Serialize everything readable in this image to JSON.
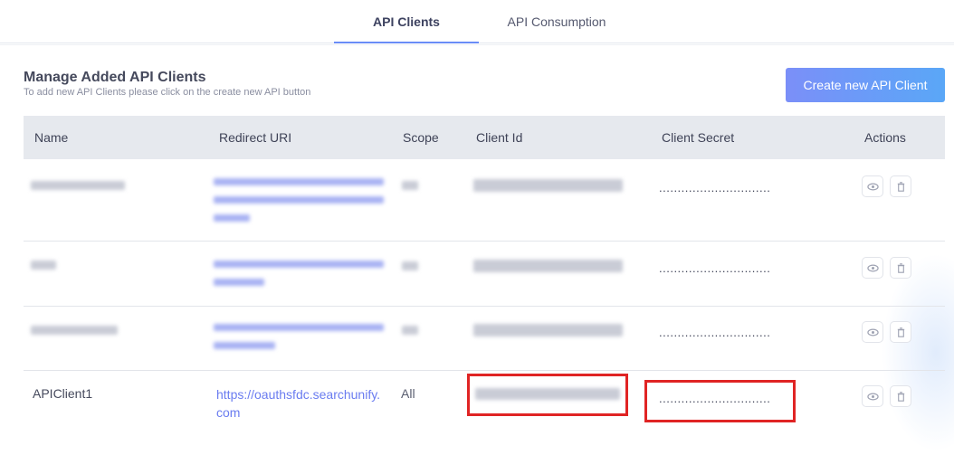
{
  "tabs": [
    {
      "label": "API Clients",
      "active": true
    },
    {
      "label": "API Consumption",
      "active": false
    }
  ],
  "header": {
    "title": "Manage Added API Clients",
    "subtitle": "To add new API Clients please click on the create new API button",
    "create_button": "Create new API Client"
  },
  "table": {
    "columns": [
      "Name",
      "Redirect URI",
      "Scope",
      "Client Id",
      "Client Secret",
      "Actions"
    ],
    "rows": [
      {
        "name": "",
        "redirect_uri": "",
        "scope": "",
        "client_id": "",
        "client_secret": "..............................",
        "blurred": true
      },
      {
        "name": "",
        "redirect_uri": "",
        "scope": "",
        "client_id": "",
        "client_secret": "..............................",
        "blurred": true
      },
      {
        "name": "",
        "redirect_uri": "",
        "scope": "",
        "client_id": "",
        "client_secret": "..............................",
        "blurred": true
      },
      {
        "name": "APIClient1",
        "redirect_uri": "https://oauthsfdc.searchunify.com",
        "scope": "All",
        "client_id": "",
        "client_secret": "..............................",
        "blurred": false
      }
    ]
  },
  "icons": {
    "view": "eye-icon",
    "delete": "trash-icon"
  },
  "colors": {
    "accent": "#6a8cf7",
    "link": "#6a7cf0",
    "highlight": "#e02424",
    "header_bg": "#e6e9ee"
  }
}
